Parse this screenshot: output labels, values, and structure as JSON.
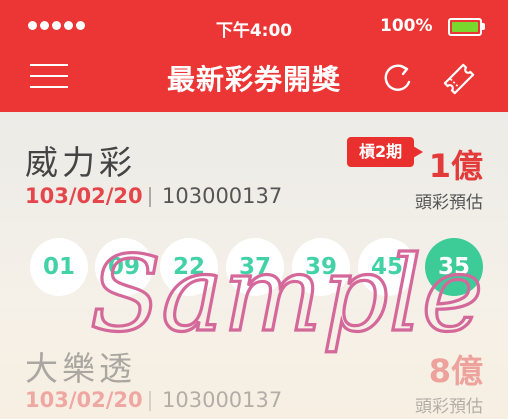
{
  "status_bar": {
    "time": "下午4:00",
    "battery_percent": "100%"
  },
  "header": {
    "title": "最新彩券開獎",
    "menu_icon": "hamburger-menu-icon",
    "refresh_icon": "refresh-icon",
    "ticket_icon": "ticket-icon"
  },
  "colors": {
    "header_red": "#ec3636",
    "ball_green": "#42d2a6",
    "special_ball": "#3dcc98",
    "date_red": "#e5464b"
  },
  "lotteries": [
    {
      "name": "威力彩",
      "date": "103/02/20",
      "draw_number": "103000137",
      "rollover_badge": "槓2期",
      "jackpot": "1億",
      "jackpot_label": "頭彩預估",
      "numbers": [
        "01",
        "09",
        "22",
        "37",
        "39",
        "45"
      ],
      "special_number": "35"
    },
    {
      "name": "大樂透",
      "date": "103/02/20",
      "draw_number": "103000137",
      "jackpot": "8億",
      "jackpot_label": "頭彩預估"
    }
  ],
  "watermark": "Sample"
}
